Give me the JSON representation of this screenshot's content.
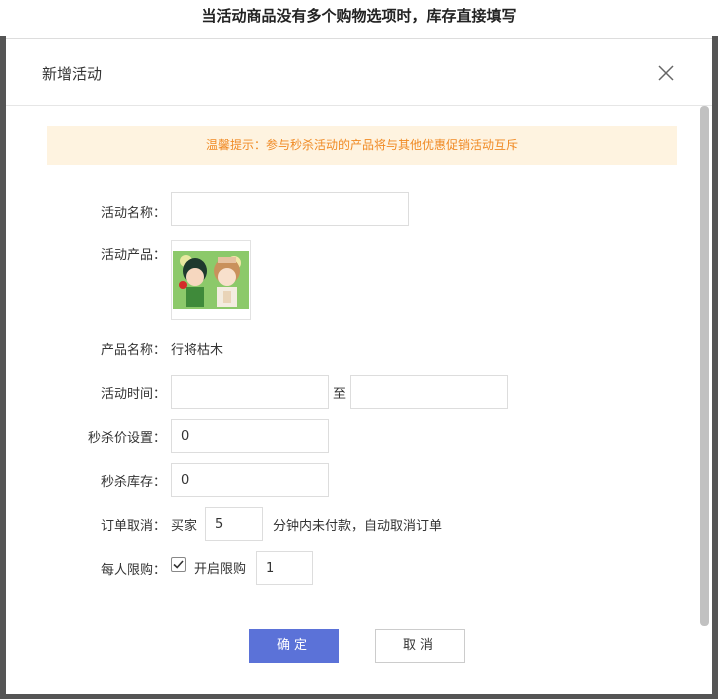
{
  "caption": "当活动商品没有多个购物选项时，库存直接填写",
  "dialog": {
    "title": "新增活动",
    "tip": "温馨提示：参与秒杀活动的产品将与其他优惠促销活动互斥",
    "fields": {
      "activity_name_label": "活动名称：",
      "activity_name_value": "",
      "activity_product_label": "活动产品：",
      "product_name_label": "产品名称：",
      "product_name_value": "行将枯木",
      "activity_time_label": "活动时间：",
      "time_start_value": "",
      "time_separator": "至",
      "time_end_value": "",
      "seckill_price_label": "秒杀价设置：",
      "seckill_price_value": "0",
      "seckill_stock_label": "秒杀库存：",
      "seckill_stock_value": "0",
      "order_cancel_label": "订单取消：",
      "order_cancel_prefix": "买家",
      "order_cancel_minutes": "5",
      "order_cancel_suffix": "分钟内未付款，自动取消订单",
      "limit_label": "每人限购：",
      "limit_checkbox_checked": true,
      "limit_checkbox_label": "开启限购",
      "limit_value": "1"
    },
    "buttons": {
      "confirm": "确定",
      "cancel": "取消"
    }
  },
  "colors": {
    "primary": "#5b72d8",
    "tip_bg": "#fef3e0",
    "tip_text": "#f08a24"
  },
  "icons": {
    "close": "close-icon",
    "check": "check-icon",
    "product": "product-thumbnail-image"
  }
}
